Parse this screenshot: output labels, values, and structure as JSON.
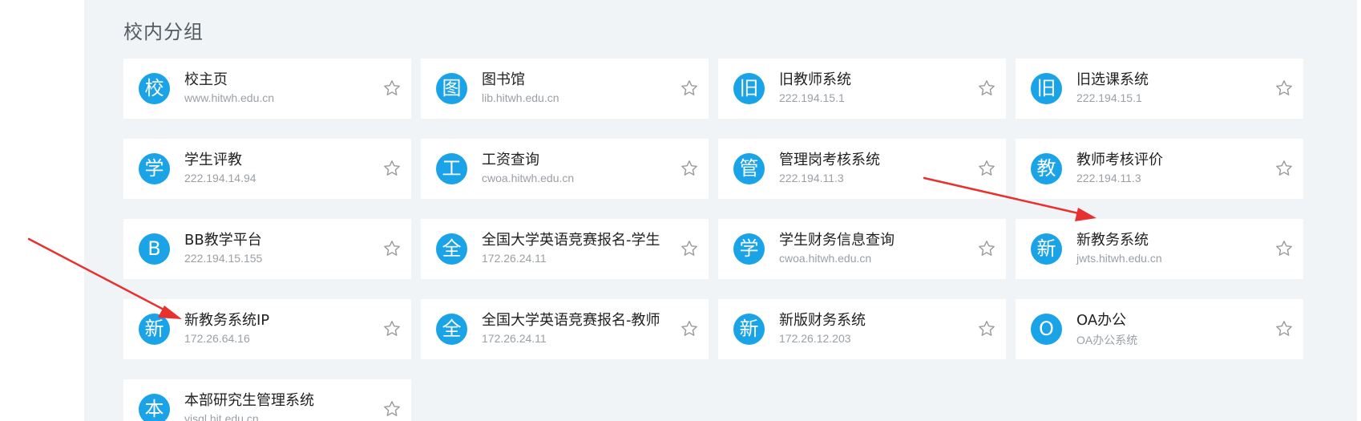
{
  "section": {
    "title": "校内分组"
  },
  "cards": [
    {
      "avatar": "校",
      "title": "校主页",
      "subtitle": "www.hitwh.edu.cn"
    },
    {
      "avatar": "图",
      "title": "图书馆",
      "subtitle": "lib.hitwh.edu.cn"
    },
    {
      "avatar": "旧",
      "title": "旧教师系统",
      "subtitle": "222.194.15.1"
    },
    {
      "avatar": "旧",
      "title": "旧选课系统",
      "subtitle": "222.194.15.1"
    },
    {
      "avatar": "学",
      "title": "学生评教",
      "subtitle": "222.194.14.94"
    },
    {
      "avatar": "工",
      "title": "工资查询",
      "subtitle": "cwoa.hitwh.edu.cn"
    },
    {
      "avatar": "管",
      "title": "管理岗考核系统",
      "subtitle": "222.194.11.3"
    },
    {
      "avatar": "教",
      "title": "教师考核评价",
      "subtitle": "222.194.11.3"
    },
    {
      "avatar": "B",
      "title": "BB教学平台",
      "subtitle": "222.194.15.155"
    },
    {
      "avatar": "全",
      "title": "全国大学英语竞赛报名-学生",
      "subtitle": "172.26.24.11"
    },
    {
      "avatar": "学",
      "title": "学生财务信息查询",
      "subtitle": "cwoa.hitwh.edu.cn"
    },
    {
      "avatar": "新",
      "title": "新教务系统",
      "subtitle": "jwts.hitwh.edu.cn"
    },
    {
      "avatar": "新",
      "title": "新教务系统IP",
      "subtitle": "172.26.64.16"
    },
    {
      "avatar": "全",
      "title": "全国大学英语竞赛报名-教师",
      "subtitle": "172.26.24.11"
    },
    {
      "avatar": "新",
      "title": "新版财务系统",
      "subtitle": "172.26.12.203"
    },
    {
      "avatar": "O",
      "title": "OA办公",
      "subtitle": "OA办公系统"
    },
    {
      "avatar": "本",
      "title": "本部研究生管理系统",
      "subtitle": "yjsgl.hit.edu.cn"
    }
  ],
  "colors": {
    "avatar_bg": "#1aa3e6",
    "page_bg": "#f1f4f6",
    "arrow": "#e8312f"
  },
  "icons": {
    "favorite": "star-outline-icon"
  }
}
